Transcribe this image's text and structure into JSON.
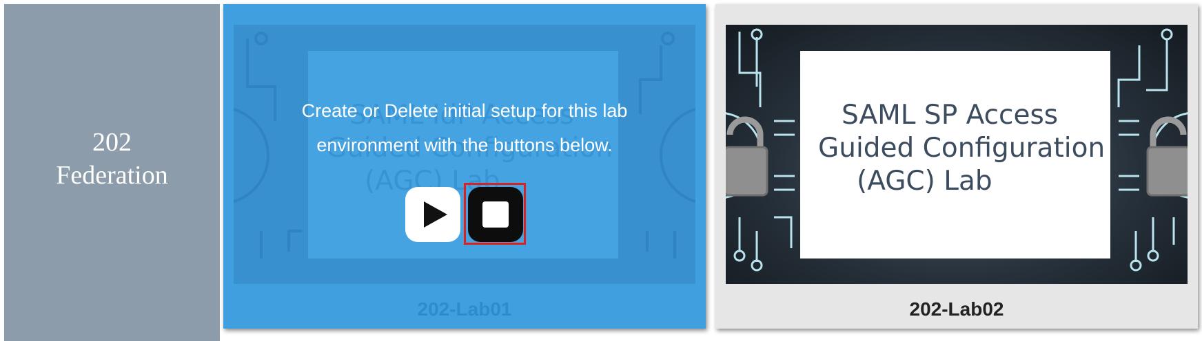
{
  "category": {
    "title_line1": "202",
    "title_line2": "Federation",
    "color": "#8c9caa"
  },
  "cards": [
    {
      "label": "202-Lab01",
      "thumbnail_text": {
        "line1": "SAML IdP Access",
        "line2": "Guided Configuration",
        "line3": "(AGC) Lab"
      },
      "overlay": {
        "message_line1": "Create or Delete initial setup for this lab",
        "message_line2": "environment with the buttons below.",
        "play_button_icon": "play-icon",
        "stop_button_icon": "stop-icon"
      },
      "color": "#3f9fdf"
    },
    {
      "label": "202-Lab02",
      "thumbnail_text": {
        "line1": "SAML SP Access",
        "line2": "Guided Configuration",
        "line3": "(AGC) Lab"
      },
      "color": "#e6e6e6"
    }
  ],
  "highlight_color": "#e0201c"
}
